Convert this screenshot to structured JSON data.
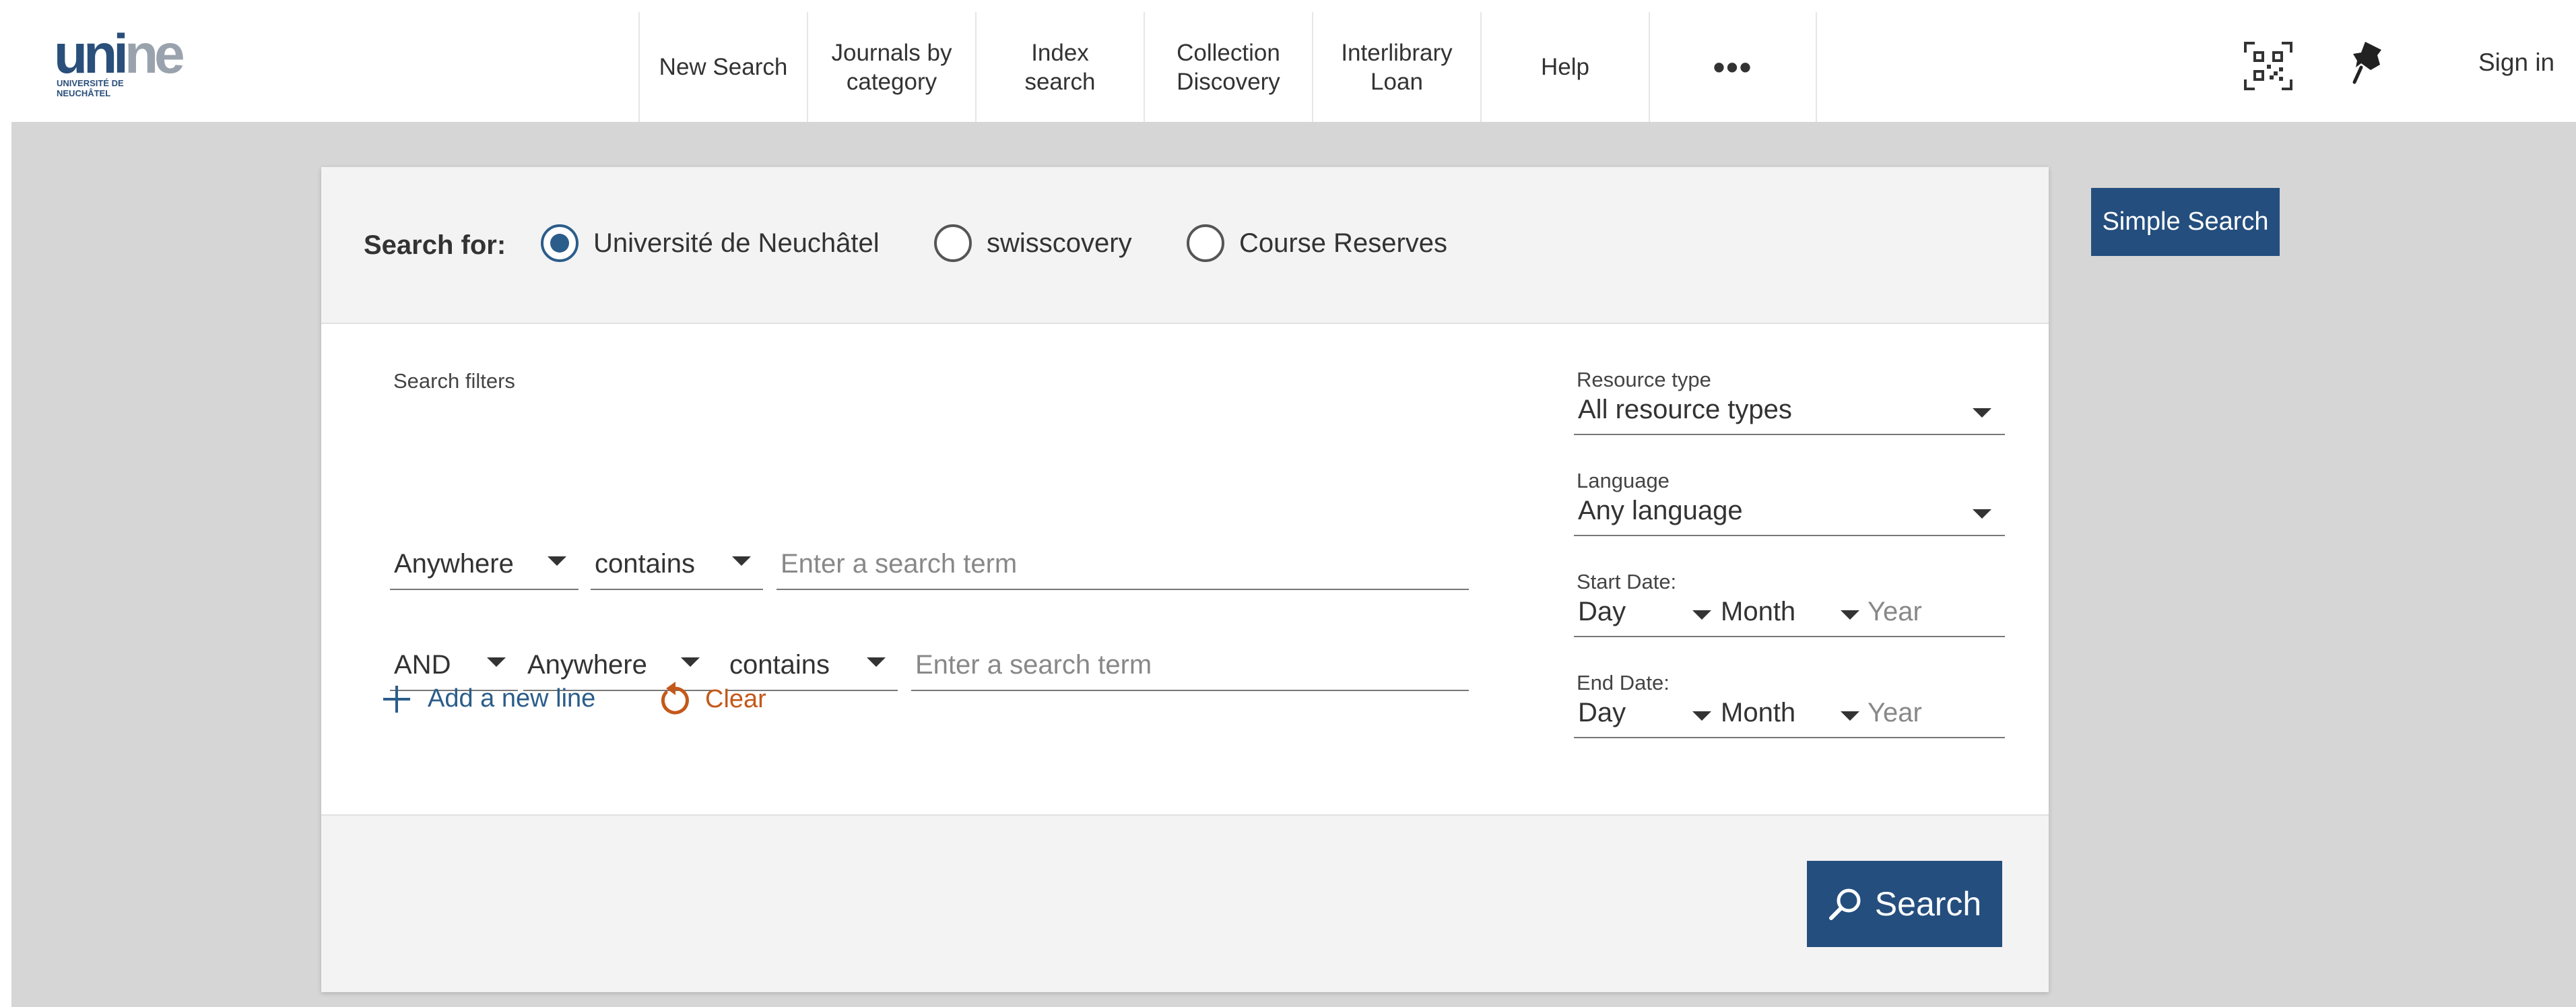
{
  "header": {
    "logo_word_a": "uni",
    "logo_word_b": "ne",
    "logo_sub": "UNIVERSITÉ DE NEUCHÂTEL",
    "nav": [
      {
        "label": "New Search"
      },
      {
        "label": "Journals by\ncategory"
      },
      {
        "label": "Index\nsearch"
      },
      {
        "label": "Collection\nDiscovery"
      },
      {
        "label": "Interlibrary\nLoan"
      },
      {
        "label": "Help"
      },
      {
        "label": "•••"
      }
    ],
    "sign_in": "Sign in"
  },
  "scope": {
    "label": "Search for:",
    "options": [
      {
        "label": "Université de Neuchâtel",
        "checked": true
      },
      {
        "label": "swisscovery",
        "checked": false
      },
      {
        "label": "Course Reserves",
        "checked": false
      }
    ]
  },
  "filters": {
    "title": "Search filters",
    "row1": {
      "field": "Anywhere",
      "operator": "contains",
      "placeholder": "Enter a search term"
    },
    "row2": {
      "boolean": "AND",
      "field": "Anywhere",
      "operator": "contains",
      "placeholder": "Enter a search term"
    },
    "add_line": "Add a new line",
    "clear": "Clear"
  },
  "side": {
    "resource_type_label": "Resource type",
    "resource_type_value": "All resource types",
    "language_label": "Language",
    "language_value": "Any language",
    "start_date_label": "Start Date:",
    "end_date_label": "End Date:",
    "day": "Day",
    "month": "Month",
    "year": "Year"
  },
  "search_button": "Search",
  "simple_search": "Simple Search",
  "colors": {
    "primary": "#244e7e",
    "accent_link": "#2b5d8a",
    "clear": "#c4581a",
    "page_bg": "#d6d6d6"
  }
}
